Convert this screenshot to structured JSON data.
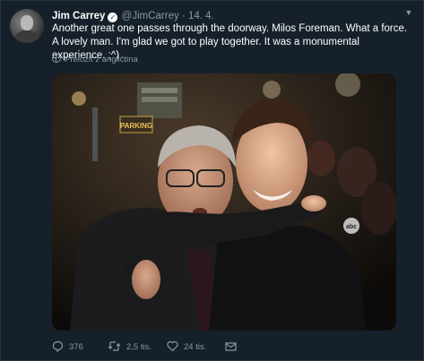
{
  "tweet": {
    "author_name": "Jim Carrey",
    "handle": "@JimCarrey",
    "separator": "·",
    "date": "14. 4.",
    "text": "Another great one passes through the doorway. Milos Foreman. What a force. A lovely man. I'm glad we got to play together. It was a monumental experience. ;^)",
    "translate_label": "Přeložit z angličtina"
  },
  "actions": {
    "replies": "376",
    "retweets": "2,5 tis.",
    "likes": "24 tis."
  },
  "photo": {
    "sign_text": "PARKING",
    "logo_text": "abc"
  },
  "colors": {
    "background": "#15202b",
    "secondary_text": "#8899a6",
    "primary_text": "#ffffff"
  }
}
